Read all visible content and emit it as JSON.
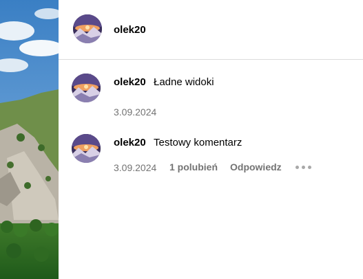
{
  "post": {
    "author": "olek20"
  },
  "comments": [
    {
      "username": "olek20",
      "text": "Ładne widoki",
      "date": "3.09.2024"
    },
    {
      "username": "olek20",
      "text": "Testowy komentarz",
      "date": "3.09.2024",
      "likes_label": "1 polubień",
      "reply_label": "Odpowiedz"
    }
  ],
  "icons": {
    "more": "more-options-icon"
  },
  "colors": {
    "meta_text": "#737373",
    "divider": "#dbdbdb",
    "dots": "#a8a8a8"
  }
}
